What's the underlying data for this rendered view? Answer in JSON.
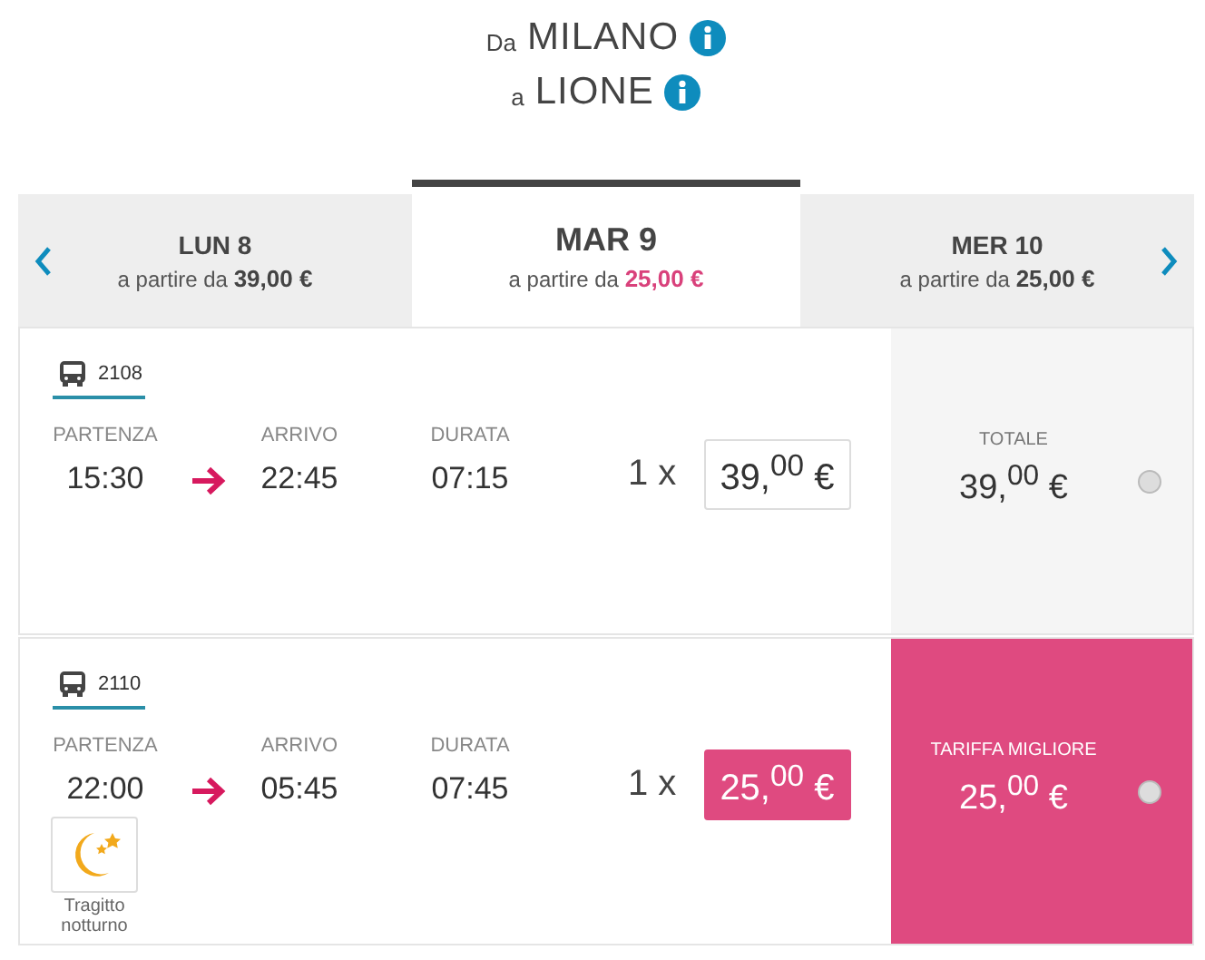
{
  "route": {
    "from_prefix": "Da",
    "from": "MILANO",
    "to_prefix": "a",
    "to": "LIONE"
  },
  "dates": [
    {
      "day": "LUN 8",
      "from_label": "a partire da",
      "price": "39,00 €",
      "selected": false
    },
    {
      "day": "MAR 9",
      "from_label": "a partire da",
      "price": "25,00 €",
      "selected": true
    },
    {
      "day": "MER 10",
      "from_label": "a partire da",
      "price": "25,00 €",
      "selected": false
    }
  ],
  "trips": [
    {
      "number": "2108",
      "departure_label": "PARTENZA",
      "departure": "15:30",
      "arrival_label": "ARRIVO",
      "arrival": "22:45",
      "duration_label": "DURATA",
      "duration": "07:15",
      "quantity": "1 x",
      "price": "39,$^{00}$ €",
      "best": false,
      "total_label": "TOTALE",
      "total": "39,$^{00}$ €",
      "selected": false
    },
    {
      "number": "2110",
      "departure_label": "PARTENZA",
      "departure": "22:00",
      "arrival_label": "ARRIVO",
      "arrival": "05:45",
      "duration_label": "DURATA",
      "duration": "07:45",
      "quantity": "1 x",
      "price": "25,$^{00}$ €",
      "best": true,
      "total_label": "TARIFFA MIGLIORE",
      "total": "25,$^{00}$ €",
      "selected": false,
      "night_label": "Tragitto notturno"
    }
  ]
}
